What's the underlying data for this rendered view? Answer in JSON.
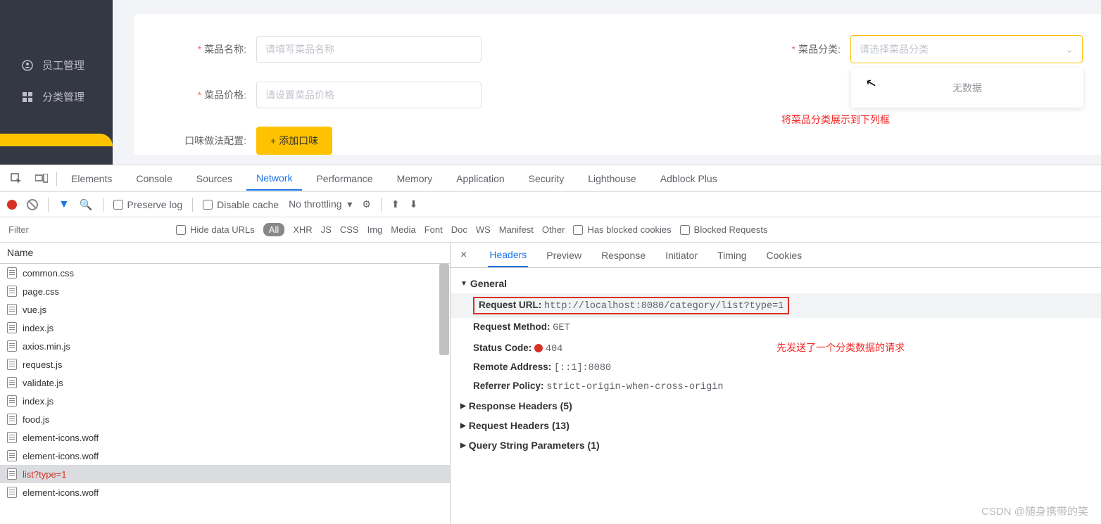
{
  "sidebar": {
    "items": [
      {
        "label": "员工管理"
      },
      {
        "label": "分类管理"
      }
    ]
  },
  "form": {
    "name_label": "菜品名称:",
    "name_placeholder": "请填写菜品名称",
    "category_label": "菜品分类:",
    "category_placeholder": "请选择菜品分类",
    "category_empty": "无数据",
    "price_label": "菜品价格:",
    "price_placeholder": "请设置菜品价格",
    "flavor_label": "口味做法配置:",
    "add_flavor_btn": "+ 添加口味"
  },
  "annotations": {
    "note1": "将菜品分类展示到下列框",
    "note2": "先发送了一个分类数据的请求"
  },
  "devtools": {
    "tabs": [
      "Elements",
      "Console",
      "Sources",
      "Network",
      "Performance",
      "Memory",
      "Application",
      "Security",
      "Lighthouse",
      "Adblock Plus"
    ],
    "active_tab": "Network",
    "toolbar": {
      "preserve_log": "Preserve log",
      "disable_cache": "Disable cache",
      "throttling": "No throttling"
    },
    "filter": {
      "placeholder": "Filter",
      "hide_data_urls": "Hide data URLs",
      "types": [
        "All",
        "XHR",
        "JS",
        "CSS",
        "Img",
        "Media",
        "Font",
        "Doc",
        "WS",
        "Manifest",
        "Other"
      ],
      "has_blocked": "Has blocked cookies",
      "blocked_req": "Blocked Requests"
    },
    "netlist": {
      "header": "Name",
      "rows": [
        "common.css",
        "page.css",
        "vue.js",
        "index.js",
        "axios.min.js",
        "request.js",
        "validate.js",
        "index.js",
        "food.js",
        "element-icons.woff",
        "element-icons.woff",
        "list?type=1",
        "element-icons.woff"
      ],
      "selected": "list?type=1"
    },
    "detail": {
      "tabs": [
        "Headers",
        "Preview",
        "Response",
        "Initiator",
        "Timing",
        "Cookies"
      ],
      "active": "Headers",
      "general": {
        "title": "General",
        "request_url_k": "Request URL:",
        "request_url_v": "http://localhost:8080/category/list?type=1",
        "method_k": "Request Method:",
        "method_v": "GET",
        "status_k": "Status Code:",
        "status_v": "404",
        "remote_k": "Remote Address:",
        "remote_v": "[::1]:8080",
        "referrer_k": "Referrer Policy:",
        "referrer_v": "strict-origin-when-cross-origin"
      },
      "response_headers": "Response Headers (5)",
      "request_headers": "Request Headers (13)",
      "query_params": "Query String Parameters (1)"
    }
  },
  "watermark": "CSDN @随身携带的笑"
}
